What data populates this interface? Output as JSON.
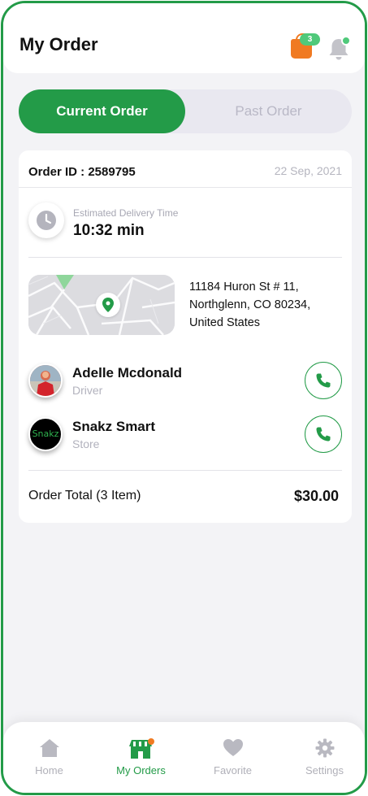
{
  "header": {
    "title": "My Order",
    "cart_count": "3"
  },
  "tabs": {
    "current": "Current Order",
    "past": "Past Order",
    "active": "current"
  },
  "order": {
    "id_label": "Order ID : 2589795",
    "date": "22 Sep, 2021",
    "estimated_label": "Estimated Delivery Time",
    "estimated_value": "10:32 min",
    "address_line1": "11184 Huron St # 11,",
    "address_line2": "Northglenn, CO 80234,",
    "address_line3": "United States",
    "driver": {
      "name": "Adelle Mcdonald",
      "role": "Driver"
    },
    "store": {
      "name": "Snakz Smart",
      "role": "Store",
      "logo_text": "Snakz"
    },
    "total_label": "Order Total (3 Item)",
    "total_value": "$30.00"
  },
  "nav": {
    "items": [
      {
        "label": "Home",
        "icon": "home-icon"
      },
      {
        "label": "My Orders",
        "icon": "store-icon"
      },
      {
        "label": "Favorite",
        "icon": "heart-icon"
      },
      {
        "label": "Settings",
        "icon": "gear-icon"
      }
    ],
    "active_index": 1
  },
  "colors": {
    "accent": "#239b48",
    "badge": "#4fc97a",
    "bag": "#f07a22",
    "background": "#f3f3f6",
    "muted_text": "#b2b2bd"
  }
}
